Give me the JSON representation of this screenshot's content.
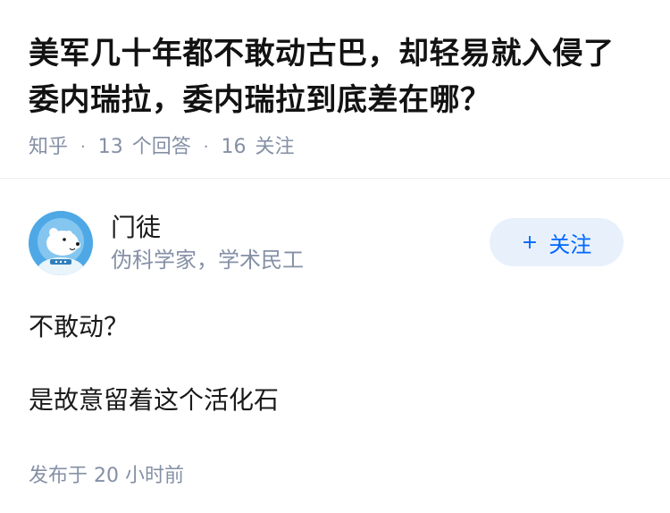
{
  "question": {
    "title": "美军几十年都不敢动古巴，却轻易就入侵了委内瑞拉，委内瑞拉到底差在哪？",
    "meta": {
      "source": "知乎",
      "answer_count": "13",
      "answer_label": "个回答",
      "follower_count": "16",
      "follower_label": "关注"
    }
  },
  "answer": {
    "author": {
      "name": "门徒",
      "bio": "伪科学家，学术民工",
      "avatar_icon": "polar-bear-astronaut-avatar"
    },
    "follow_button": {
      "plus": "+",
      "label": "关注"
    },
    "paragraphs": [
      "不敢动？",
      "是故意留着这个活化石"
    ],
    "publish_time": "发布于  20 小时前"
  },
  "colors": {
    "meta_gray": "#8590a6",
    "accent_blue": "#0066ff",
    "follow_bg": "#e8f1fb"
  }
}
